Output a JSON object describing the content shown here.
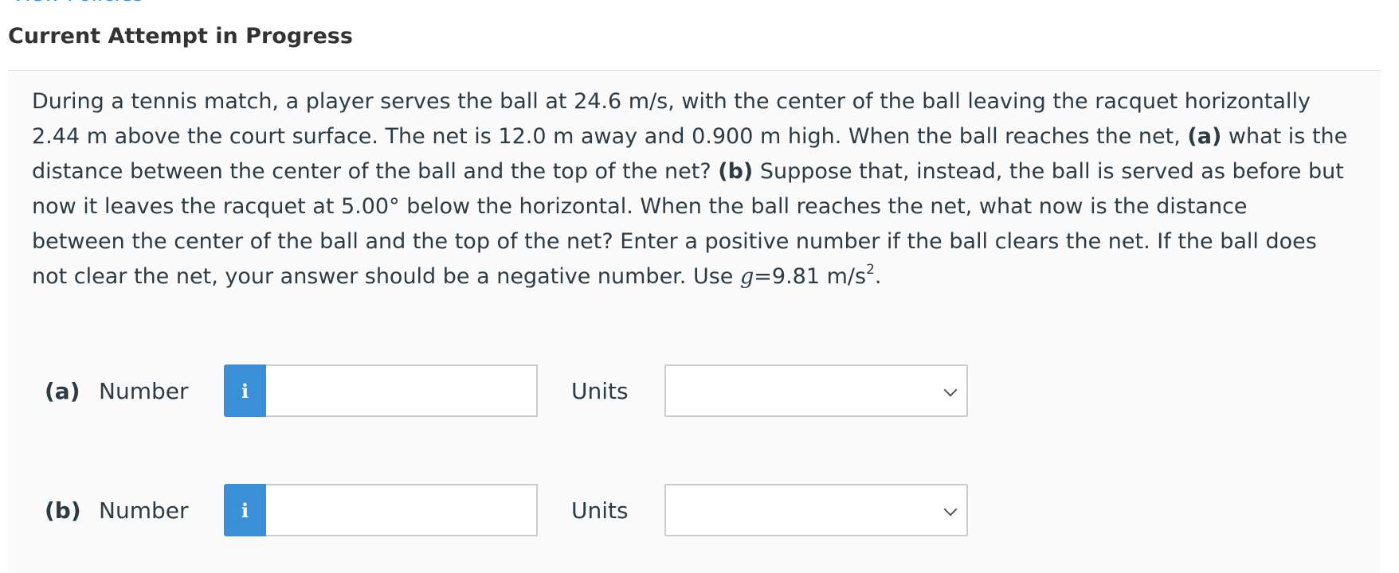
{
  "top_link": "View Policies",
  "section_title": "Current Attempt in Progress",
  "question": {
    "line1": "During a tennis match, a player serves the ball at 24.6 m/s, with the center of the ball leaving the racquet horizontally",
    "line2_a": "2.44 m above the court surface. The net is 12.0 m away and 0.900 m high. When the ball reaches the net, ",
    "line2_bold": "(a)",
    "line2_b": " what is the",
    "line3_a": "distance between the center of the ball and the top of the net? ",
    "line3_bold": "(b)",
    "line3_b": " Suppose that, instead, the ball is served as before but",
    "line4": "now it leaves the racquet at 5.00° below the horizontal. When the ball reaches the net, what now is the distance",
    "line5": "between the center of the ball and the top of the net? Enter a positive number if the ball clears the net. If the ball does",
    "line6_a": "not clear the net, your answer should be a negative number. Use ",
    "line6_var": "g",
    "line6_b": "=9.81 m/s",
    "line6_sup": "2",
    "line6_end": "."
  },
  "parts": [
    {
      "label": "(a)",
      "number_label": "Number",
      "info_icon": "i",
      "number_value": "",
      "units_label": "Units",
      "units_value": ""
    },
    {
      "label": "(b)",
      "number_label": "Number",
      "info_icon": "i",
      "number_value": "",
      "units_label": "Units",
      "units_value": ""
    }
  ],
  "colors": {
    "accent": "#3b8fd8",
    "text": "#2d3b45",
    "panel": "#fafafa",
    "border": "#c7cdd1"
  }
}
